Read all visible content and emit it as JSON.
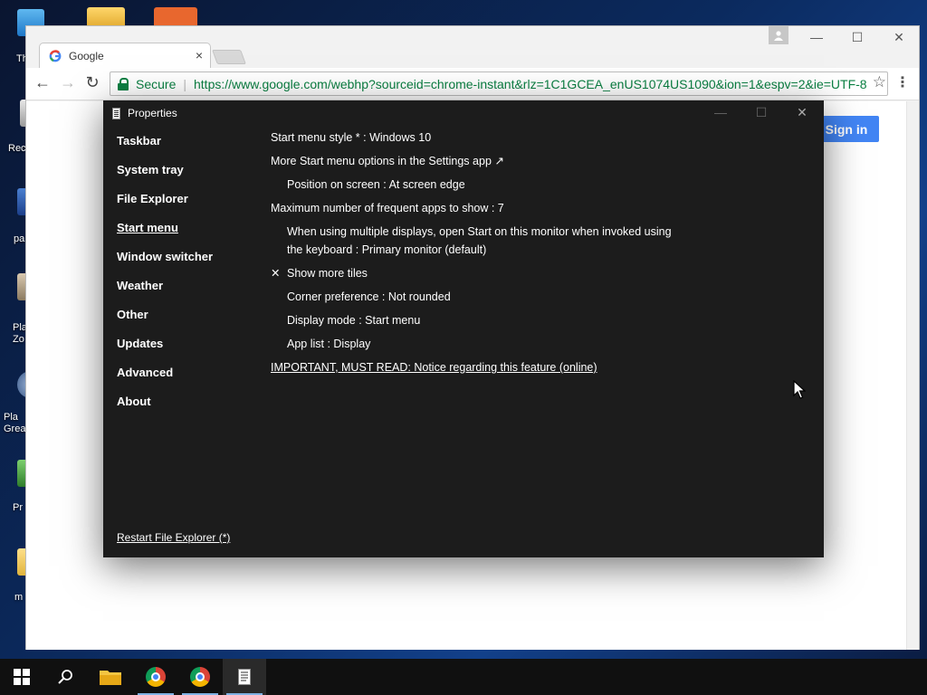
{
  "desktop": {
    "icons": [
      {
        "name": "desktop-icon-1",
        "label": "Th"
      },
      {
        "name": "desktop-icon-recycle",
        "label": "Rec"
      },
      {
        "name": "desktop-icon-3",
        "label": "pa"
      },
      {
        "name": "desktop-icon-4",
        "label": "Pla Zo"
      },
      {
        "name": "desktop-icon-5",
        "label": "Pla Grea"
      },
      {
        "name": "desktop-icon-6",
        "label": "Pr"
      },
      {
        "name": "desktop-icon-7",
        "label": "m"
      }
    ]
  },
  "browser": {
    "tab_title": "Google",
    "tab_close": "×",
    "secure_label": "Secure",
    "url": "https://www.google.com/webhp?sourceid=chrome-instant&rlz=1C1GCEA_enUS1074US1090&ion=1&espv=2&ie=UTF-8",
    "sign_in_label": "Sign in",
    "minimize": "—",
    "maximize": "☐",
    "close": "✕"
  },
  "properties": {
    "title": "Properties",
    "sidebar": [
      {
        "label": "Taskbar"
      },
      {
        "label": "System tray"
      },
      {
        "label": "File Explorer"
      },
      {
        "label": "Start menu",
        "active": true
      },
      {
        "label": "Window switcher"
      },
      {
        "label": "Weather"
      },
      {
        "label": "Other"
      },
      {
        "label": "Updates"
      },
      {
        "label": "Advanced"
      },
      {
        "label": "About"
      }
    ],
    "options": {
      "start_menu_style": "Start menu style * : Windows 10",
      "more_options": "More Start menu options in the Settings app ↗",
      "position": "Position on screen : At screen edge",
      "max_frequent": "Maximum number of frequent apps to show : 7",
      "multi_display_line1": "When using multiple displays, open Start on this monitor when invoked using",
      "multi_display_line2": "the keyboard : Primary monitor (default)",
      "show_more_tiles_check": "✕",
      "show_more_tiles": "Show more tiles",
      "corner_pref": "Corner preference : Not rounded",
      "display_mode": "Display mode : Start menu",
      "app_list": "App list : Display",
      "important_notice": "IMPORTANT, MUST READ: Notice regarding this feature (online)"
    },
    "restart_link": "Restart File Explorer (*)"
  },
  "taskbar": {
    "items": [
      "start",
      "search",
      "file-explorer",
      "chrome",
      "chrome",
      "properties"
    ]
  },
  "colors": {
    "dialog_bg": "#1c1c1c",
    "accent_blue": "#4285f4",
    "secure_green": "#0b8043"
  }
}
